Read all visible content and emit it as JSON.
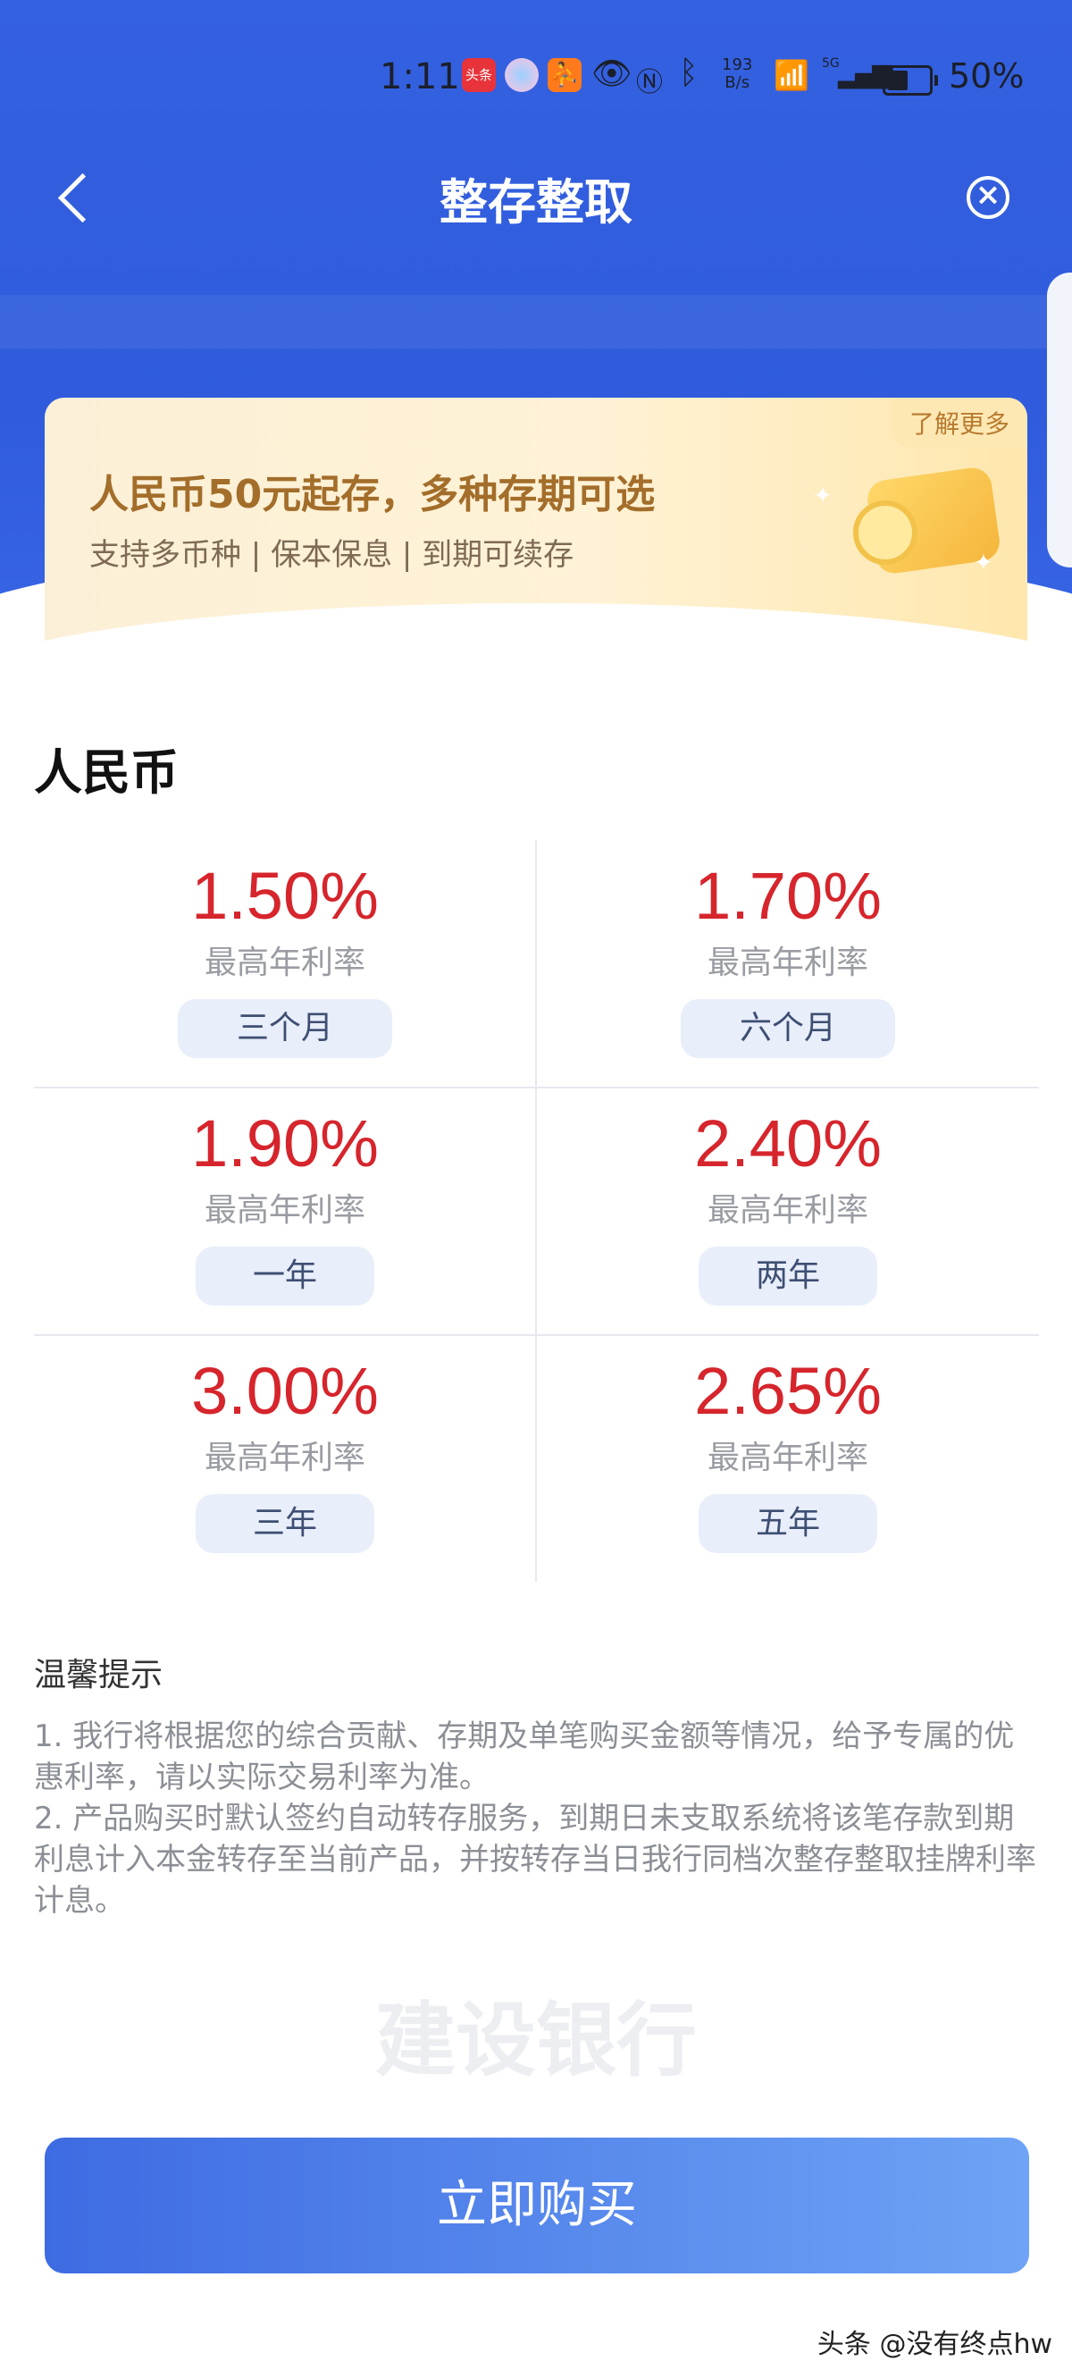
{
  "status_bar": {
    "time": "1:11",
    "app_icon_label": "头条",
    "net_speed_value": "193",
    "net_speed_unit": "B/s",
    "signal_label": "5G",
    "battery_percent": "50%",
    "battery_level": 0.5
  },
  "nav": {
    "title": "整存整取"
  },
  "banner": {
    "title": "人民币50元起存，多种存期可选",
    "subtitle": "支持多币种 | 保本保息 | 到期可续存",
    "learn_more": "了解更多"
  },
  "currency_title": "人民币",
  "rates": [
    {
      "rate": "1.50%",
      "label": "最高年利率",
      "term": "三个月"
    },
    {
      "rate": "1.70%",
      "label": "最高年利率",
      "term": "六个月"
    },
    {
      "rate": "1.90%",
      "label": "最高年利率",
      "term": "一年"
    },
    {
      "rate": "2.40%",
      "label": "最高年利率",
      "term": "两年"
    },
    {
      "rate": "3.00%",
      "label": "最高年利率",
      "term": "三年"
    },
    {
      "rate": "2.65%",
      "label": "最高年利率",
      "term": "五年"
    }
  ],
  "tips": {
    "title": "温馨提示",
    "items": [
      "1. 我行将根据您的综合贡献、存期及单笔购买金额等情况，给予专属的优惠利率，请以实际交易利率为准。",
      "2. 产品购买时默认签约自动转存服务，到期日未支取系统将该笔存款到期利息计入本金转存至当前产品，并按转存当日我行同档次整存整取挂牌利率计息。"
    ]
  },
  "watermark": "建设银行",
  "buy_button": "立即购买",
  "footer_mark": "头条 @没有终点hw",
  "colors": {
    "brand_blue": "#2f5bdc",
    "rate_red": "#d6252c"
  }
}
